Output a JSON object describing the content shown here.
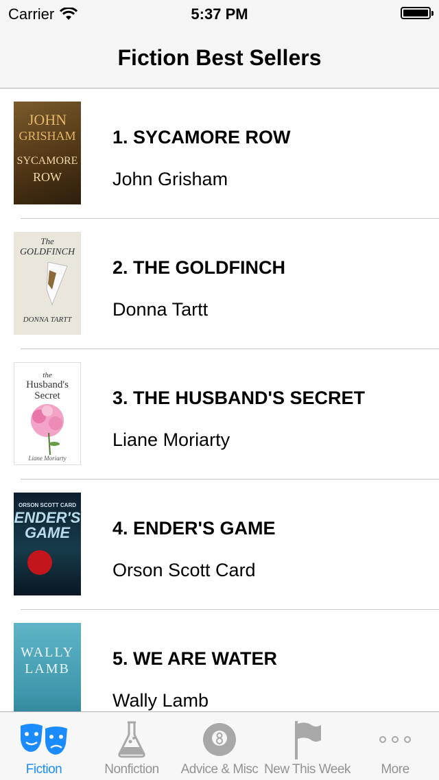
{
  "status_bar": {
    "carrier": "Carrier",
    "time": "5:37 PM"
  },
  "nav": {
    "title": "Fiction Best Sellers"
  },
  "books": [
    {
      "title": "1. SYCAMORE ROW",
      "author": "John Grisham",
      "cover_lines": [
        "JOHN",
        "GRISHAM",
        "SYCAMORE",
        "ROW"
      ]
    },
    {
      "title": "2. THE GOLDFINCH",
      "author": "Donna Tartt",
      "cover_lines": [
        "The",
        "GOLDFINCH",
        "DONNA TARTT"
      ]
    },
    {
      "title": "3. THE HUSBAND'S SECRET",
      "author": "Liane Moriarty",
      "cover_lines": [
        "the",
        "Husband's",
        "Secret",
        "Liane Moriarty"
      ]
    },
    {
      "title": "4. ENDER'S GAME",
      "author": "Orson Scott Card",
      "cover_lines": [
        "ORSON SCOTT CARD",
        "ENDER'S",
        "GAME"
      ]
    },
    {
      "title": "5. WE ARE WATER",
      "author": "Wally Lamb",
      "cover_lines": [
        "WALLY",
        "LAMB"
      ]
    }
  ],
  "tabs": [
    {
      "label": "Fiction",
      "icon": "theater-masks-icon",
      "active": true
    },
    {
      "label": "Nonfiction",
      "icon": "flask-icon",
      "active": false
    },
    {
      "label": "Advice & Misc",
      "icon": "eight-ball-icon",
      "active": false
    },
    {
      "label": "New This Week",
      "icon": "flag-icon",
      "active": false
    },
    {
      "label": "More",
      "icon": "more-dots-icon",
      "active": false
    }
  ],
  "colors": {
    "accent": "#1a8cff",
    "inactive": "#929292",
    "bar_bg": "#f7f7f7"
  }
}
